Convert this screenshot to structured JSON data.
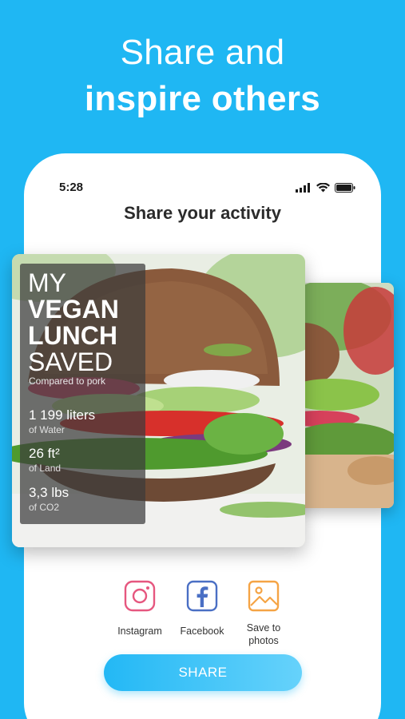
{
  "headline": {
    "line1": "Share and",
    "line2": "inspire others"
  },
  "status_bar": {
    "time": "5:28"
  },
  "screen_title": "Share your activity",
  "card": {
    "title_line1": "MY",
    "title_line2": "VEGAN",
    "title_line3": "LUNCH",
    "title_line4": "SAVED",
    "subtitle": "Compared to pork",
    "stats": [
      {
        "value": "1 199 liters",
        "unit": "of Water"
      },
      {
        "value": "26 ft²",
        "unit": "of Land"
      },
      {
        "value": "3,3 lbs",
        "unit": "of CO2"
      }
    ]
  },
  "share_options": [
    {
      "label": "Instagram",
      "icon": "instagram-icon",
      "color": "#e6577f"
    },
    {
      "label": "Facebook",
      "icon": "facebook-icon",
      "color": "#4a6fc4"
    },
    {
      "label": "Save to\nphotos",
      "icon": "photos-icon",
      "color": "#f5a445"
    }
  ],
  "share_button": {
    "label": "SHARE"
  },
  "colors": {
    "background": "#1fb7f3",
    "accent": "#23b8f5"
  }
}
